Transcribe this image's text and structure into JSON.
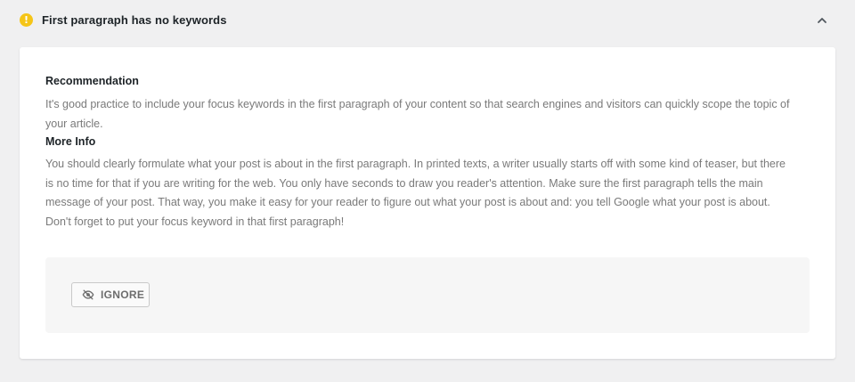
{
  "header": {
    "title": "First paragraph has no keywords",
    "status_icon": "warning-info-icon",
    "toggle_icon": "chevron-up-icon"
  },
  "recommendation": {
    "heading": "Recommendation",
    "text": "It's good practice to include your focus keywords in the first paragraph of your content so that search engines and visitors can quickly scope the topic of your article."
  },
  "more_info": {
    "heading": "More Info",
    "text": "You should clearly formulate what your post is about in the first paragraph. In printed texts, a writer usually starts off with some kind of teaser, but there is no time for that if you are writing for the web. You only have seconds to draw you reader's attention. Make sure the first paragraph tells the main message of your post. That way, you make it easy for your reader to figure out what your post is about and: you tell Google what your post is about. Don't forget to put your focus keyword in that first paragraph!"
  },
  "actions": {
    "ignore_label": "IGNORE",
    "ignore_icon": "eye-slash-icon"
  },
  "colors": {
    "warning": "#f5c518",
    "page_bg": "#f0f0f1",
    "card_bg": "#ffffff",
    "body_text": "#7a7a7a"
  }
}
